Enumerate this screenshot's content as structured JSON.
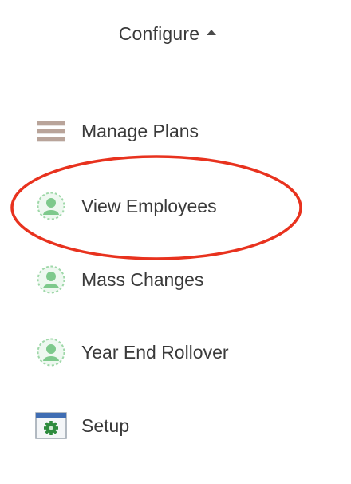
{
  "header": {
    "label": "Configure",
    "caret_icon": "caret-up-icon"
  },
  "menu": {
    "items": [
      {
        "label": "Manage Plans",
        "icon": "stack-bars-icon"
      },
      {
        "label": "View Employees",
        "icon": "person-icon"
      },
      {
        "label": "Mass Changes",
        "icon": "person-icon"
      },
      {
        "label": "Year End Rollover",
        "icon": "person-icon"
      },
      {
        "label": "Setup",
        "icon": "settings-window-icon"
      }
    ]
  },
  "annotation": {
    "highlight_color": "#e8321e",
    "target": "View Employees"
  },
  "colors": {
    "text": "#3a3a3a",
    "divider": "#d6d6d6",
    "person_icon": "#7ec98c",
    "stack_icon": "#b9a49a",
    "window_icon_bar": "#3f6db3",
    "window_icon_gear": "#2e8b3e"
  }
}
